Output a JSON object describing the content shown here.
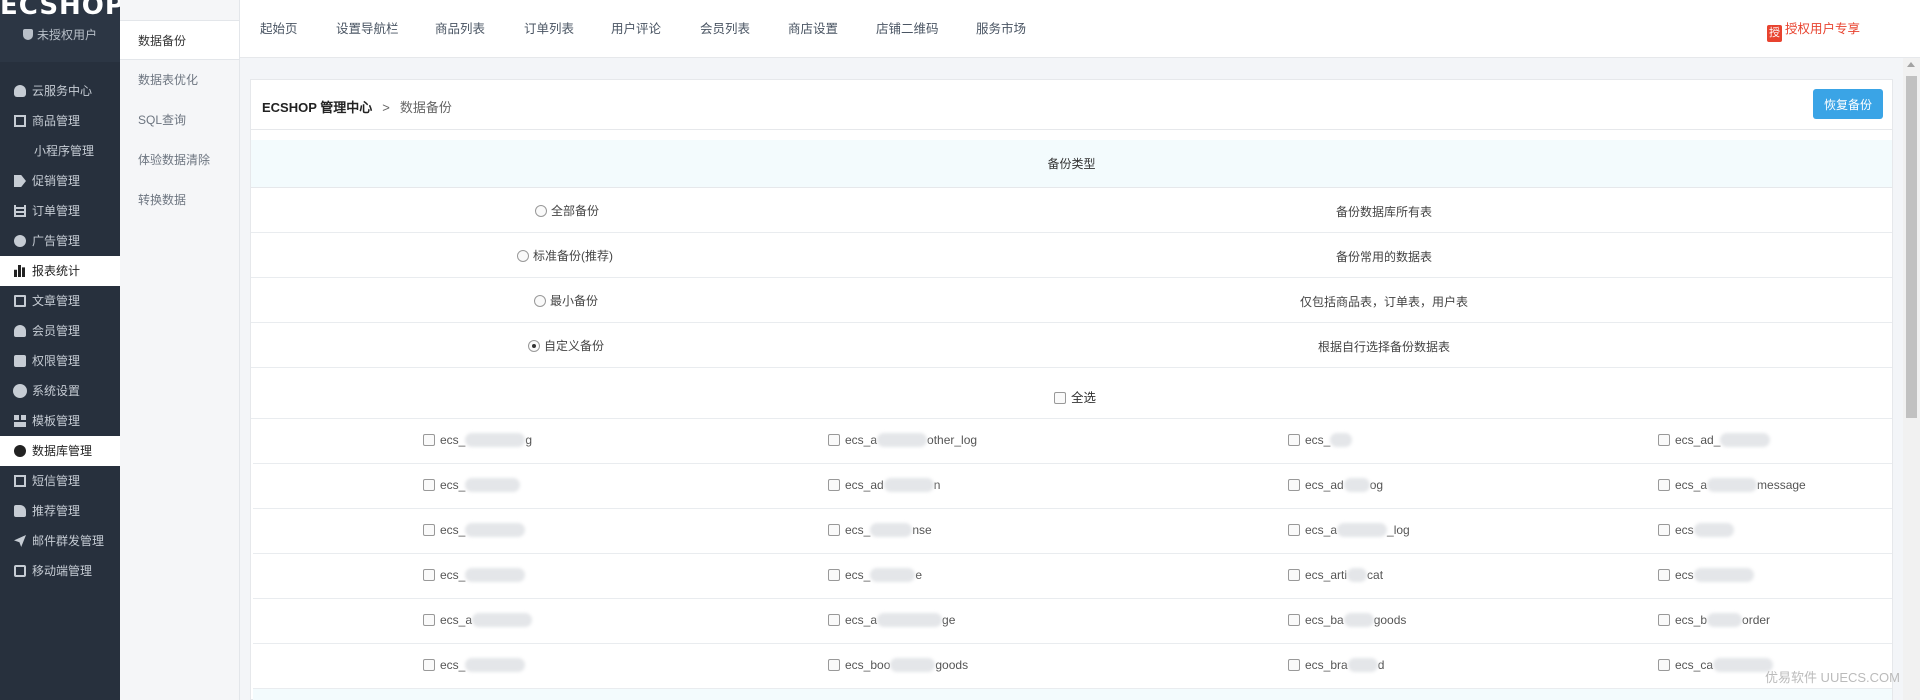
{
  "sidebar": {
    "logo": "ECSHOP",
    "auth_status": "未授权用户",
    "menu": [
      {
        "label": "云服务中心",
        "icon": "cloud-icon"
      },
      {
        "label": "商品管理",
        "icon": "box-icon"
      },
      {
        "label": "小程序管理",
        "icon": ""
      },
      {
        "label": "促销管理",
        "icon": "tag-icon"
      },
      {
        "label": "订单管理",
        "icon": "list-icon"
      },
      {
        "label": "广告管理",
        "icon": "circle-icon"
      },
      {
        "label": "报表统计",
        "icon": "bar-chart-icon"
      },
      {
        "label": "文章管理",
        "icon": "document-icon"
      },
      {
        "label": "会员管理",
        "icon": "user-icon"
      },
      {
        "label": "权限管理",
        "icon": "lock-icon"
      },
      {
        "label": "系统设置",
        "icon": "gear-icon"
      },
      {
        "label": "模板管理",
        "icon": "grid-icon"
      },
      {
        "label": "数据库管理",
        "icon": "pie-chart-icon"
      },
      {
        "label": "短信管理",
        "icon": "mail-icon"
      },
      {
        "label": "推荐管理",
        "icon": "thumbs-up-icon"
      },
      {
        "label": "邮件群发管理",
        "icon": "paper-plane-icon"
      },
      {
        "label": "移动端管理",
        "icon": "phone-icon"
      }
    ]
  },
  "subnav": [
    "数据备份",
    "数据表优化",
    "SQL查询",
    "体验数据清除",
    "转换数据"
  ],
  "topnav": {
    "items": [
      "起始页",
      "设置导航栏",
      "商品列表",
      "订单列表",
      "用户评论",
      "会员列表",
      "商店设置",
      "店铺二维码",
      "服务市场"
    ],
    "auth_badge": "授",
    "auth_link": "授权用户专享"
  },
  "header": {
    "crumb_root": "ECSHOP 管理中心",
    "crumb_sep": ">",
    "crumb_current": "数据备份",
    "restore_button": "恢复备份"
  },
  "backup": {
    "type_heading": "备份类型",
    "options": [
      {
        "label": "全部备份",
        "desc": "备份数据库所有表",
        "checked": false
      },
      {
        "label": "标准备份(推荐)",
        "desc": "备份常用的数据表",
        "checked": false
      },
      {
        "label": "最小备份",
        "desc": "仅包括商品表，订单表，用户表",
        "checked": false
      },
      {
        "label": "自定义备份",
        "desc": "根据自行选择备份数据表",
        "checked": true
      }
    ],
    "select_all": "全选",
    "tables": [
      [
        "ecs_",
        "ecs_a",
        "ecs_",
        "ecs_ad_"
      ],
      [
        "ecs_",
        "ecs_ad",
        "ecs_ad",
        "ecs_a"
      ],
      [
        "ecs_",
        "ecs_",
        "ecs_a",
        "ecs"
      ],
      [
        "ecs_",
        "ecs_",
        "ecs_arti",
        "ecs"
      ],
      [
        "ecs_a",
        "ecs_a",
        "ecs_ba",
        "ecs_b"
      ],
      [
        "ecs_",
        "ecs_boo",
        "ecs_bra",
        "ecs_ca"
      ]
    ],
    "tables_suffix": [
      [
        "g",
        "other_log",
        "",
        ""
      ],
      [
        "",
        "n",
        "og",
        "message"
      ],
      [
        "",
        "nse",
        "_log",
        ""
      ],
      [
        "",
        "e",
        "cat",
        ""
      ],
      [
        "",
        "ge",
        "goods",
        "order"
      ],
      [
        "",
        "goods",
        "d",
        ""
      ]
    ]
  },
  "watermark": "优易软件 UUECS.COM"
}
